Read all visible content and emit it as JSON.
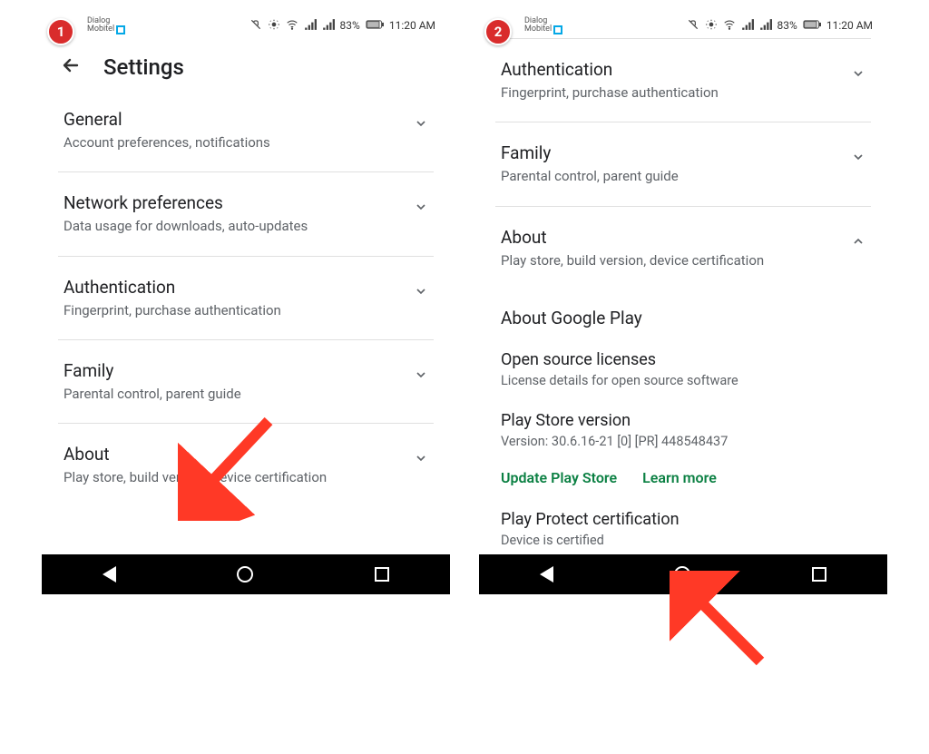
{
  "statusbar": {
    "carrier1": "Dialog",
    "carrier2": "Mobitel",
    "battery": "83%",
    "time": "11:20 AM"
  },
  "left": {
    "step": "1",
    "header_title": "Settings",
    "items": [
      {
        "title": "General",
        "sub": "Account preferences, notifications"
      },
      {
        "title": "Network preferences",
        "sub": "Data usage for downloads, auto-updates"
      },
      {
        "title": "Authentication",
        "sub": "Fingerprint, purchase authentication"
      },
      {
        "title": "Family",
        "sub": "Parental control, parent guide"
      },
      {
        "title": "About",
        "sub": "Play store, build version, device certification"
      }
    ]
  },
  "right": {
    "step": "2",
    "items": [
      {
        "title": "Authentication",
        "sub": "Fingerprint, purchase authentication",
        "chev": "down"
      },
      {
        "title": "Family",
        "sub": "Parental control, parent guide",
        "chev": "down"
      },
      {
        "title": "About",
        "sub": "Play store, build version, device certification",
        "chev": "up"
      }
    ],
    "about": {
      "heading": "About Google Play",
      "licenses_title": "Open source licenses",
      "licenses_sub": "License details for open source software",
      "version_title": "Play Store version",
      "version_sub": "Version: 30.6.16-21 [0] [PR] 448548437",
      "update_label": "Update Play Store",
      "learn_more_label": "Learn more",
      "protect_title": "Play Protect certification",
      "protect_sub": "Device is certified"
    }
  }
}
